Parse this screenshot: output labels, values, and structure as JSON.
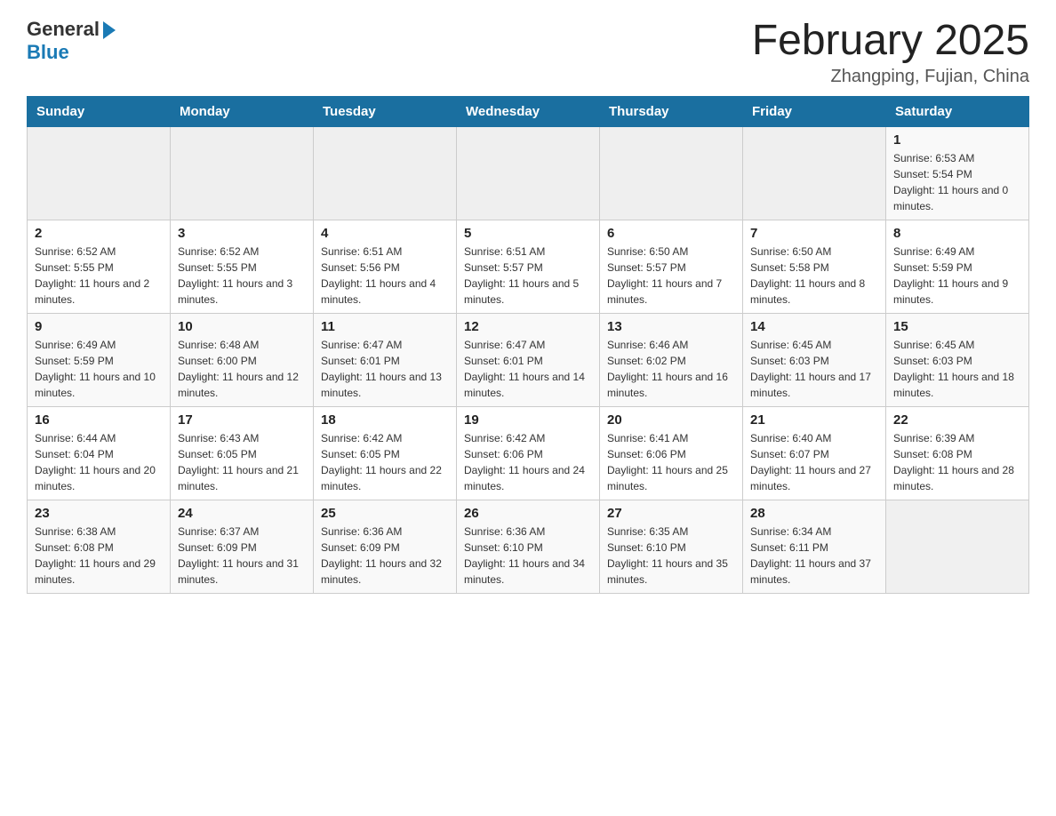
{
  "header": {
    "logo_general": "General",
    "logo_blue": "Blue",
    "month_title": "February 2025",
    "location": "Zhangping, Fujian, China"
  },
  "days_of_week": [
    "Sunday",
    "Monday",
    "Tuesday",
    "Wednesday",
    "Thursday",
    "Friday",
    "Saturday"
  ],
  "weeks": [
    [
      {
        "day": "",
        "info": ""
      },
      {
        "day": "",
        "info": ""
      },
      {
        "day": "",
        "info": ""
      },
      {
        "day": "",
        "info": ""
      },
      {
        "day": "",
        "info": ""
      },
      {
        "day": "",
        "info": ""
      },
      {
        "day": "1",
        "info": "Sunrise: 6:53 AM\nSunset: 5:54 PM\nDaylight: 11 hours and 0 minutes."
      }
    ],
    [
      {
        "day": "2",
        "info": "Sunrise: 6:52 AM\nSunset: 5:55 PM\nDaylight: 11 hours and 2 minutes."
      },
      {
        "day": "3",
        "info": "Sunrise: 6:52 AM\nSunset: 5:55 PM\nDaylight: 11 hours and 3 minutes."
      },
      {
        "day": "4",
        "info": "Sunrise: 6:51 AM\nSunset: 5:56 PM\nDaylight: 11 hours and 4 minutes."
      },
      {
        "day": "5",
        "info": "Sunrise: 6:51 AM\nSunset: 5:57 PM\nDaylight: 11 hours and 5 minutes."
      },
      {
        "day": "6",
        "info": "Sunrise: 6:50 AM\nSunset: 5:57 PM\nDaylight: 11 hours and 7 minutes."
      },
      {
        "day": "7",
        "info": "Sunrise: 6:50 AM\nSunset: 5:58 PM\nDaylight: 11 hours and 8 minutes."
      },
      {
        "day": "8",
        "info": "Sunrise: 6:49 AM\nSunset: 5:59 PM\nDaylight: 11 hours and 9 minutes."
      }
    ],
    [
      {
        "day": "9",
        "info": "Sunrise: 6:49 AM\nSunset: 5:59 PM\nDaylight: 11 hours and 10 minutes."
      },
      {
        "day": "10",
        "info": "Sunrise: 6:48 AM\nSunset: 6:00 PM\nDaylight: 11 hours and 12 minutes."
      },
      {
        "day": "11",
        "info": "Sunrise: 6:47 AM\nSunset: 6:01 PM\nDaylight: 11 hours and 13 minutes."
      },
      {
        "day": "12",
        "info": "Sunrise: 6:47 AM\nSunset: 6:01 PM\nDaylight: 11 hours and 14 minutes."
      },
      {
        "day": "13",
        "info": "Sunrise: 6:46 AM\nSunset: 6:02 PM\nDaylight: 11 hours and 16 minutes."
      },
      {
        "day": "14",
        "info": "Sunrise: 6:45 AM\nSunset: 6:03 PM\nDaylight: 11 hours and 17 minutes."
      },
      {
        "day": "15",
        "info": "Sunrise: 6:45 AM\nSunset: 6:03 PM\nDaylight: 11 hours and 18 minutes."
      }
    ],
    [
      {
        "day": "16",
        "info": "Sunrise: 6:44 AM\nSunset: 6:04 PM\nDaylight: 11 hours and 20 minutes."
      },
      {
        "day": "17",
        "info": "Sunrise: 6:43 AM\nSunset: 6:05 PM\nDaylight: 11 hours and 21 minutes."
      },
      {
        "day": "18",
        "info": "Sunrise: 6:42 AM\nSunset: 6:05 PM\nDaylight: 11 hours and 22 minutes."
      },
      {
        "day": "19",
        "info": "Sunrise: 6:42 AM\nSunset: 6:06 PM\nDaylight: 11 hours and 24 minutes."
      },
      {
        "day": "20",
        "info": "Sunrise: 6:41 AM\nSunset: 6:06 PM\nDaylight: 11 hours and 25 minutes."
      },
      {
        "day": "21",
        "info": "Sunrise: 6:40 AM\nSunset: 6:07 PM\nDaylight: 11 hours and 27 minutes."
      },
      {
        "day": "22",
        "info": "Sunrise: 6:39 AM\nSunset: 6:08 PM\nDaylight: 11 hours and 28 minutes."
      }
    ],
    [
      {
        "day": "23",
        "info": "Sunrise: 6:38 AM\nSunset: 6:08 PM\nDaylight: 11 hours and 29 minutes."
      },
      {
        "day": "24",
        "info": "Sunrise: 6:37 AM\nSunset: 6:09 PM\nDaylight: 11 hours and 31 minutes."
      },
      {
        "day": "25",
        "info": "Sunrise: 6:36 AM\nSunset: 6:09 PM\nDaylight: 11 hours and 32 minutes."
      },
      {
        "day": "26",
        "info": "Sunrise: 6:36 AM\nSunset: 6:10 PM\nDaylight: 11 hours and 34 minutes."
      },
      {
        "day": "27",
        "info": "Sunrise: 6:35 AM\nSunset: 6:10 PM\nDaylight: 11 hours and 35 minutes."
      },
      {
        "day": "28",
        "info": "Sunrise: 6:34 AM\nSunset: 6:11 PM\nDaylight: 11 hours and 37 minutes."
      },
      {
        "day": "",
        "info": ""
      }
    ]
  ]
}
